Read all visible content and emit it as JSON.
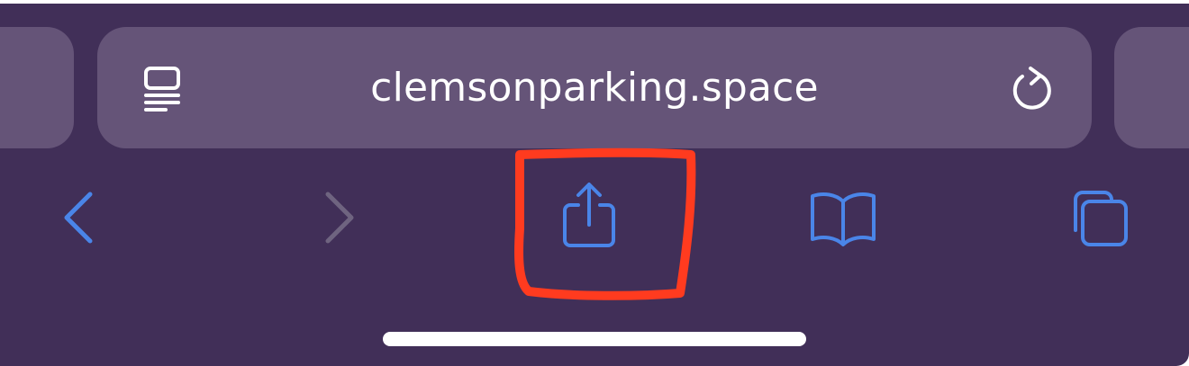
{
  "url_bar": {
    "url": "clemsonparking.space",
    "reader_icon": "reader-mode-icon",
    "reload_icon": "reload-icon"
  },
  "toolbar": {
    "back_icon": "chevron-left-icon",
    "forward_icon": "chevron-right-icon",
    "share_icon": "share-icon",
    "bookmarks_icon": "book-icon",
    "tabs_icon": "tabs-icon"
  },
  "colors": {
    "background": "#412f58",
    "url_bar": "#655478",
    "accent": "#4a85e8",
    "disabled": "#6f6480",
    "annotation": "#ff3b1f",
    "text": "#ffffff"
  }
}
